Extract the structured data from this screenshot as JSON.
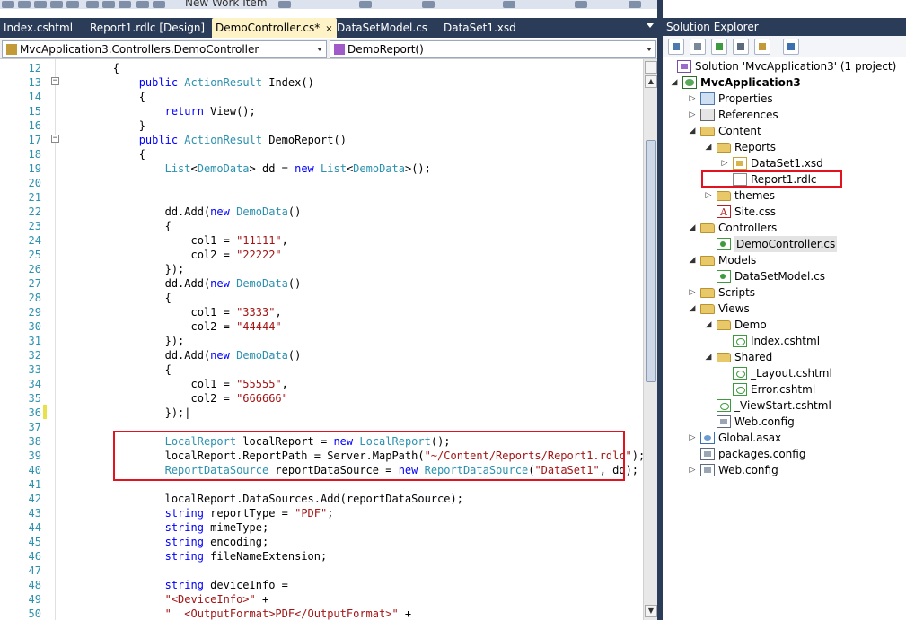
{
  "toolbar": {
    "combo_text": "New Work Item"
  },
  "tabs": [
    {
      "label": "Index.cshtml",
      "active": false
    },
    {
      "label": "Report1.rdlc [Design]",
      "active": false
    },
    {
      "label": "DemoController.cs*",
      "active": true
    },
    {
      "label": "DataSetModel.cs",
      "active": false
    },
    {
      "label": "DataSet1.xsd",
      "active": false
    }
  ],
  "tab_close_glyph": "×",
  "navbar": {
    "class_selector": "MvcApplication3.Controllers.DemoController",
    "member_selector": "DemoReport()"
  },
  "editor": {
    "line_numbers": [
      "12",
      "13",
      "14",
      "15",
      "16",
      "17",
      "18",
      "19",
      "20",
      "21",
      "22",
      "23",
      "24",
      "25",
      "26",
      "27",
      "28",
      "29",
      "30",
      "31",
      "32",
      "33",
      "34",
      "35",
      "36",
      "37",
      "38",
      "39",
      "40",
      "41",
      "42",
      "43",
      "44",
      "45",
      "46",
      "47",
      "48",
      "49",
      "50"
    ],
    "fold_glyph": "−",
    "scroll_up": "▲",
    "scroll_down": "▼",
    "code": [
      [
        {
          "t": "        {",
          "c": ""
        }
      ],
      [
        {
          "t": "            ",
          "c": ""
        },
        {
          "t": "public",
          "c": "kw"
        },
        {
          "t": " ",
          "c": ""
        },
        {
          "t": "ActionResult",
          "c": "ty"
        },
        {
          "t": " Index()",
          "c": ""
        }
      ],
      [
        {
          "t": "            {",
          "c": ""
        }
      ],
      [
        {
          "t": "                ",
          "c": ""
        },
        {
          "t": "return",
          "c": "kw"
        },
        {
          "t": " View();",
          "c": ""
        }
      ],
      [
        {
          "t": "            }",
          "c": ""
        }
      ],
      [
        {
          "t": "            ",
          "c": ""
        },
        {
          "t": "public",
          "c": "kw"
        },
        {
          "t": " ",
          "c": ""
        },
        {
          "t": "ActionResult",
          "c": "ty"
        },
        {
          "t": " DemoReport()",
          "c": ""
        }
      ],
      [
        {
          "t": "            {",
          "c": ""
        }
      ],
      [
        {
          "t": "                ",
          "c": ""
        },
        {
          "t": "List",
          "c": "ty"
        },
        {
          "t": "<",
          "c": ""
        },
        {
          "t": "DemoData",
          "c": "ty"
        },
        {
          "t": "> dd = ",
          "c": ""
        },
        {
          "t": "new",
          "c": "kw"
        },
        {
          "t": " ",
          "c": ""
        },
        {
          "t": "List",
          "c": "ty"
        },
        {
          "t": "<",
          "c": ""
        },
        {
          "t": "DemoData",
          "c": "ty"
        },
        {
          "t": ">();",
          "c": ""
        }
      ],
      [
        {
          "t": "",
          "c": ""
        }
      ],
      [
        {
          "t": "",
          "c": ""
        }
      ],
      [
        {
          "t": "                dd.Add(",
          "c": ""
        },
        {
          "t": "new",
          "c": "kw"
        },
        {
          "t": " ",
          "c": ""
        },
        {
          "t": "DemoData",
          "c": "ty"
        },
        {
          "t": "()",
          "c": ""
        }
      ],
      [
        {
          "t": "                {",
          "c": ""
        }
      ],
      [
        {
          "t": "                    col1 = ",
          "c": ""
        },
        {
          "t": "\"11111\"",
          "c": "str"
        },
        {
          "t": ",",
          "c": ""
        }
      ],
      [
        {
          "t": "                    col2 = ",
          "c": ""
        },
        {
          "t": "\"22222\"",
          "c": "str"
        }
      ],
      [
        {
          "t": "                });",
          "c": ""
        }
      ],
      [
        {
          "t": "                dd.Add(",
          "c": ""
        },
        {
          "t": "new",
          "c": "kw"
        },
        {
          "t": " ",
          "c": ""
        },
        {
          "t": "DemoData",
          "c": "ty"
        },
        {
          "t": "()",
          "c": ""
        }
      ],
      [
        {
          "t": "                {",
          "c": ""
        }
      ],
      [
        {
          "t": "                    col1 = ",
          "c": ""
        },
        {
          "t": "\"3333\"",
          "c": "str"
        },
        {
          "t": ",",
          "c": ""
        }
      ],
      [
        {
          "t": "                    col2 = ",
          "c": ""
        },
        {
          "t": "\"44444\"",
          "c": "str"
        }
      ],
      [
        {
          "t": "                });",
          "c": ""
        }
      ],
      [
        {
          "t": "                dd.Add(",
          "c": ""
        },
        {
          "t": "new",
          "c": "kw"
        },
        {
          "t": " ",
          "c": ""
        },
        {
          "t": "DemoData",
          "c": "ty"
        },
        {
          "t": "()",
          "c": ""
        }
      ],
      [
        {
          "t": "                {",
          "c": ""
        }
      ],
      [
        {
          "t": "                    col1 = ",
          "c": ""
        },
        {
          "t": "\"55555\"",
          "c": "str"
        },
        {
          "t": ",",
          "c": ""
        }
      ],
      [
        {
          "t": "                    col2 = ",
          "c": ""
        },
        {
          "t": "\"666666\"",
          "c": "str"
        }
      ],
      [
        {
          "t": "                });|",
          "c": ""
        }
      ],
      [
        {
          "t": "",
          "c": ""
        }
      ],
      [
        {
          "t": "                ",
          "c": ""
        },
        {
          "t": "LocalReport",
          "c": "ty"
        },
        {
          "t": " localReport = ",
          "c": ""
        },
        {
          "t": "new",
          "c": "kw"
        },
        {
          "t": " ",
          "c": ""
        },
        {
          "t": "LocalReport",
          "c": "ty"
        },
        {
          "t": "();",
          "c": ""
        }
      ],
      [
        {
          "t": "                localReport.ReportPath = Server.MapPath(",
          "c": ""
        },
        {
          "t": "\"~/Content/Reports/Report1.rdlc\"",
          "c": "str"
        },
        {
          "t": ");",
          "c": ""
        }
      ],
      [
        {
          "t": "                ",
          "c": ""
        },
        {
          "t": "ReportDataSource",
          "c": "ty"
        },
        {
          "t": " reportDataSource = ",
          "c": ""
        },
        {
          "t": "new",
          "c": "kw"
        },
        {
          "t": " ",
          "c": ""
        },
        {
          "t": "ReportDataSource",
          "c": "ty"
        },
        {
          "t": "(",
          "c": ""
        },
        {
          "t": "\"DataSet1\"",
          "c": "str"
        },
        {
          "t": ", dd);",
          "c": ""
        }
      ],
      [
        {
          "t": "",
          "c": ""
        }
      ],
      [
        {
          "t": "                localReport.DataSources.Add(reportDataSource);",
          "c": ""
        }
      ],
      [
        {
          "t": "                ",
          "c": ""
        },
        {
          "t": "string",
          "c": "kw"
        },
        {
          "t": " reportType = ",
          "c": ""
        },
        {
          "t": "\"PDF\"",
          "c": "str"
        },
        {
          "t": ";",
          "c": ""
        }
      ],
      [
        {
          "t": "                ",
          "c": ""
        },
        {
          "t": "string",
          "c": "kw"
        },
        {
          "t": " mimeType;",
          "c": ""
        }
      ],
      [
        {
          "t": "                ",
          "c": ""
        },
        {
          "t": "string",
          "c": "kw"
        },
        {
          "t": " encoding;",
          "c": ""
        }
      ],
      [
        {
          "t": "                ",
          "c": ""
        },
        {
          "t": "string",
          "c": "kw"
        },
        {
          "t": " fileNameExtension;",
          "c": ""
        }
      ],
      [
        {
          "t": "",
          "c": ""
        }
      ],
      [
        {
          "t": "                ",
          "c": ""
        },
        {
          "t": "string",
          "c": "kw"
        },
        {
          "t": " deviceInfo =",
          "c": ""
        }
      ],
      [
        {
          "t": "                ",
          "c": ""
        },
        {
          "t": "\"<DeviceInfo>\"",
          "c": "str"
        },
        {
          "t": " +",
          "c": ""
        }
      ],
      [
        {
          "t": "                ",
          "c": ""
        },
        {
          "t": "\"  <OutputFormat>PDF</OutputFormat>\"",
          "c": "str"
        },
        {
          "t": " +",
          "c": ""
        }
      ]
    ]
  },
  "solution_explorer": {
    "title": "Solution Explorer",
    "tree": [
      {
        "label": "Solution 'MvcApplication3' (1 project)",
        "icon": "solution-icon",
        "expander": "",
        "bold": false
      },
      {
        "label": "MvcApplication3",
        "icon": "project-icon",
        "expander": "◢",
        "bold": true
      },
      {
        "label": "Properties",
        "icon": "props-icon",
        "expander": "▷",
        "bold": false
      },
      {
        "label": "References",
        "icon": "refs-icon",
        "expander": "▷",
        "bold": false
      },
      {
        "label": "Content",
        "icon": "folder-icon",
        "expander": "◢",
        "bold": false
      },
      {
        "label": "Reports",
        "icon": "folder-icon",
        "expander": "◢",
        "bold": false
      },
      {
        "label": "DataSet1.xsd",
        "icon": "xsd-icon",
        "expander": "▷",
        "bold": false
      },
      {
        "label": "Report1.rdlc",
        "icon": "rdlc-icon",
        "expander": "",
        "bold": false
      },
      {
        "label": "themes",
        "icon": "folder-icon",
        "expander": "▷",
        "bold": false
      },
      {
        "label": "Site.css",
        "icon": "css-icon",
        "expander": "",
        "bold": false
      },
      {
        "label": "Controllers",
        "icon": "folder-icon",
        "expander": "◢",
        "bold": false
      },
      {
        "label": "DemoController.cs",
        "icon": "cs-icon",
        "expander": "",
        "bold": false,
        "selected": true
      },
      {
        "label": "Models",
        "icon": "folder-icon",
        "expander": "◢",
        "bold": false
      },
      {
        "label": "DataSetModel.cs",
        "icon": "cs-icon",
        "expander": "",
        "bold": false
      },
      {
        "label": "Scripts",
        "icon": "folder-icon",
        "expander": "▷",
        "bold": false
      },
      {
        "label": "Views",
        "icon": "folder-icon",
        "expander": "◢",
        "bold": false
      },
      {
        "label": "Demo",
        "icon": "folder-icon",
        "expander": "◢",
        "bold": false
      },
      {
        "label": "Index.cshtml",
        "icon": "cshtml-icon",
        "expander": "",
        "bold": false
      },
      {
        "label": "Shared",
        "icon": "folder-icon",
        "expander": "◢",
        "bold": false
      },
      {
        "label": "_Layout.cshtml",
        "icon": "cshtml-icon",
        "expander": "",
        "bold": false
      },
      {
        "label": "Error.cshtml",
        "icon": "cshtml-icon",
        "expander": "",
        "bold": false
      },
      {
        "label": "_ViewStart.cshtml",
        "icon": "cshtml-icon",
        "expander": "",
        "bold": false
      },
      {
        "label": "Web.config",
        "icon": "config-icon",
        "expander": "",
        "bold": false
      },
      {
        "label": "Global.asax",
        "icon": "asax-icon",
        "expander": "▷",
        "bold": false
      },
      {
        "label": "packages.config",
        "icon": "config-icon",
        "expander": "",
        "bold": false
      },
      {
        "label": "Web.config",
        "icon": "config-icon",
        "expander": "▷",
        "bold": false
      }
    ]
  },
  "colors": {
    "tab_bar": "#2b3c59",
    "active_tab": "#fdf3c7",
    "keyword": "#0000ff",
    "type": "#2b91af",
    "string": "#a31515",
    "highlight_box": "#e2121f"
  }
}
